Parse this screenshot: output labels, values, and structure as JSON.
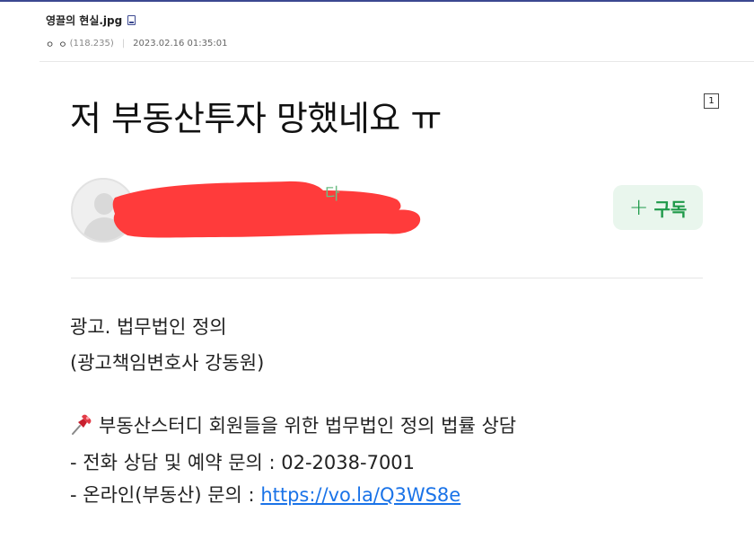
{
  "file": {
    "title": "영끌의 현실.jpg",
    "icon": "mobile-icon"
  },
  "meta": {
    "nickname": "ㅇ ㅇ",
    "ip": "(118.235)",
    "separator": "|",
    "timestamp": "2023.02.16 01:35:01"
  },
  "page_badge": "1",
  "post": {
    "title": "저 부동산투자 망했네요 ㅠ",
    "author_avatar": "default-avatar-icon",
    "redaction_color": "#ff3b3b"
  },
  "subscribe": {
    "plus": "+",
    "label": "구독",
    "color": "#1f9a4a",
    "background": "#e9f6ed"
  },
  "body": {
    "line1": "광고. 법무법인 정의",
    "line2": "(광고책임변호사 강동원)",
    "line3": "부동산스터디 회원들을 위한 법무법인 정의 법률 상담",
    "line4": "- 전화 상담 및 예약 문의 : 02-2038-7001",
    "line5_prefix": "- 온라인(부동산) 문의 : ",
    "line5_link": "https://vo.la/Q3WS8e",
    "pin_icon": "pushpin-icon"
  }
}
